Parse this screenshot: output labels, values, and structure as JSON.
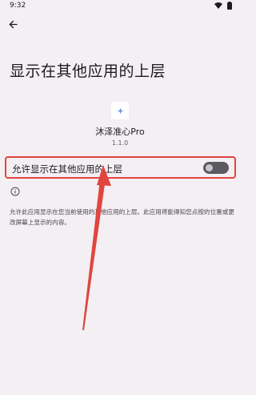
{
  "status_bar": {
    "time": "9:32",
    "icons": [
      "wifi-icon",
      "battery-icon"
    ]
  },
  "top_bar": {
    "back_icon": "arrow-left-icon"
  },
  "page": {
    "title": "显示在其他应用的上层"
  },
  "app": {
    "icon": "app-icon",
    "name": "沐泽准心Pro",
    "version": "1.1.0"
  },
  "permission": {
    "label": "允许显示在其他应用的上层",
    "enabled": false
  },
  "info": {
    "icon": "info-icon",
    "text": "允许此应用显示在您当前使用的其他应用的上层。此应用将能得知您点按的位置或更改屏幕上显示的内容。"
  },
  "annotation": {
    "highlight_color": "#e0463f",
    "arrow_color": "#e0463f"
  }
}
